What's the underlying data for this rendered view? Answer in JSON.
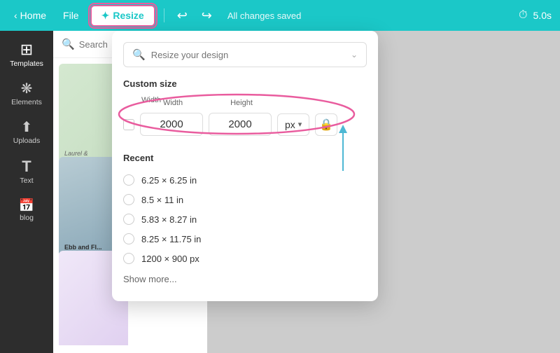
{
  "topbar": {
    "home_label": "Home",
    "file_label": "File",
    "resize_label": "✦ Resize",
    "saved_text": "All changes saved",
    "timer": "5.0s"
  },
  "sidebar": {
    "items": [
      {
        "id": "templates",
        "label": "Templates",
        "icon": "⊞"
      },
      {
        "id": "elements",
        "label": "Elements",
        "icon": "✦"
      },
      {
        "id": "uploads",
        "label": "Uploads",
        "icon": "☁"
      },
      {
        "id": "text",
        "label": "Text",
        "icon": "T"
      },
      {
        "id": "blog",
        "label": "blog",
        "icon": "🗓"
      }
    ]
  },
  "panel": {
    "search_placeholder": "Search"
  },
  "resize_panel": {
    "search_placeholder": "Resize your design",
    "custom_size_label": "Custom size",
    "width_label": "Width",
    "height_label": "Height",
    "width_value": "2000",
    "height_value": "2000",
    "unit": "px",
    "recent_label": "Recent",
    "recent_items": [
      {
        "label": "6.25 × 6.25 in"
      },
      {
        "label": "8.5 × 11 in"
      },
      {
        "label": "5.83 × 8.27 in"
      },
      {
        "label": "8.25 × 11.75 in"
      },
      {
        "label": "1200 × 900 px"
      }
    ],
    "show_more_label": "Show more..."
  }
}
